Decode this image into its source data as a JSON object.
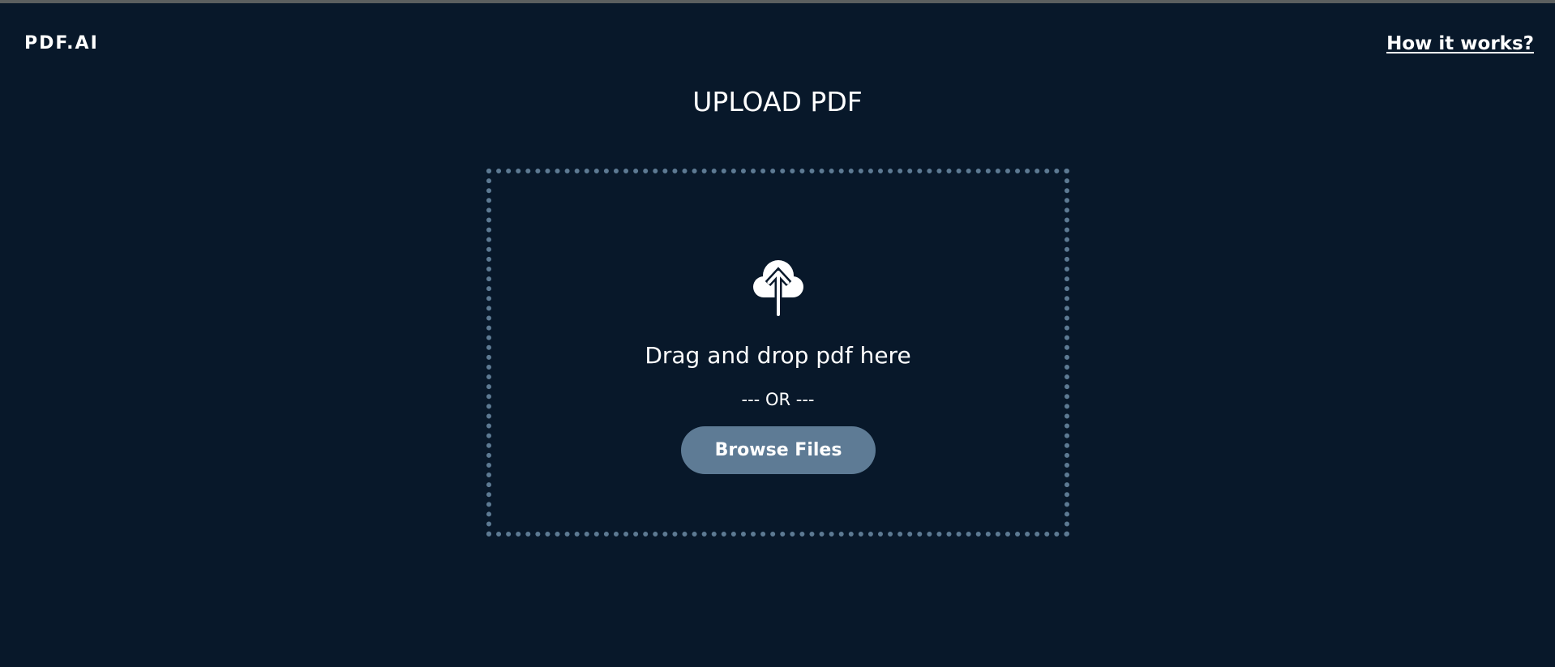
{
  "header": {
    "logo": "PDF.AI",
    "help_link": "How it works?"
  },
  "main": {
    "title": "UPLOAD PDF",
    "dropzone": {
      "icon": "cloud-upload-icon",
      "instruction": "Drag and drop pdf here",
      "separator": "--- OR ---",
      "browse_label": "Browse Files"
    }
  },
  "colors": {
    "background": "#08182a",
    "accent": "#5e7b95",
    "text": "#ffffff"
  }
}
